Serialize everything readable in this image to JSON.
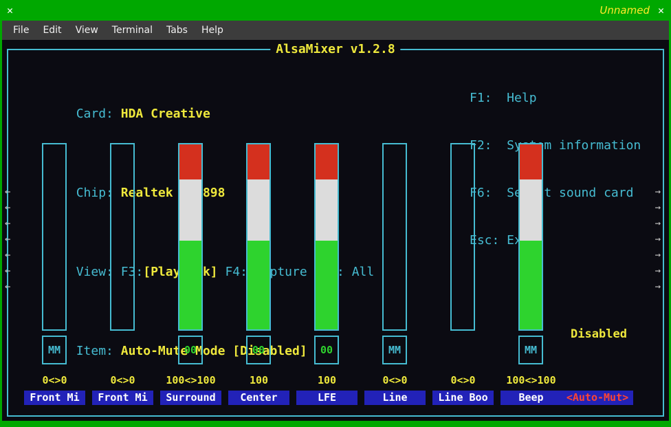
{
  "window": {
    "title": "Unnamed",
    "close_glyph": "✕"
  },
  "menu": {
    "items": [
      "File",
      "Edit",
      "View",
      "Terminal",
      "Tabs",
      "Help"
    ]
  },
  "mixer": {
    "title": "AlsaMixer v1.2.8",
    "card_label": "Card: ",
    "card_value": "HDA Creative",
    "chip_label": "Chip: ",
    "chip_value": "Realtek ALC898",
    "view_prefix": "View: F3:",
    "view_playback": "[Playback]",
    "view_suffix": " F4: Capture  F5: All",
    "item_label": "Item: ",
    "item_value": "Auto-Mute Mode [Disabled]",
    "help": [
      "F1:  Help",
      "F2:  System information",
      "F6:  Select sound card",
      "Esc: Exit"
    ],
    "scroll": {
      "left_glyph": "←",
      "right_glyph": "→",
      "count": 7
    },
    "colors": {
      "green_frame": "#00a800",
      "cyan": "#46bcd2",
      "yellow": "#eee83c",
      "blue": "#2222b8",
      "sel_red": "#ff4433",
      "bar_red": "#d4301e",
      "bar_white": "#dcdcdc",
      "bar_green": "#2ed32e"
    },
    "bar_segments": [
      {
        "color": "bar_red",
        "pct": 19
      },
      {
        "color": "bar_white",
        "pct": 33
      },
      {
        "color": "bar_green",
        "pct": 48
      }
    ],
    "channels": [
      {
        "label": "Front Mi",
        "value": "0<>0",
        "switch": "MM",
        "has_switch": true,
        "filled": false
      },
      {
        "label": "Front Mi",
        "value": "0<>0",
        "switch": "",
        "has_switch": false,
        "filled": false
      },
      {
        "label": "Surround",
        "value": "100<>100",
        "switch": "00",
        "has_switch": true,
        "filled": true
      },
      {
        "label": "Center",
        "value": "100",
        "switch": "00",
        "has_switch": true,
        "filled": true
      },
      {
        "label": "LFE",
        "value": "100",
        "switch": "00",
        "has_switch": true,
        "filled": true
      },
      {
        "label": "Line",
        "value": "0<>0",
        "switch": "MM",
        "has_switch": true,
        "filled": false
      },
      {
        "label": "Line Boo",
        "value": "0<>0",
        "switch": "",
        "has_switch": false,
        "filled": false
      },
      {
        "label": "Beep",
        "value": "100<>100",
        "switch": "MM",
        "has_switch": true,
        "filled": true
      }
    ],
    "selected_item": {
      "label": "<Auto-Mut>",
      "value": "Disabled"
    }
  }
}
